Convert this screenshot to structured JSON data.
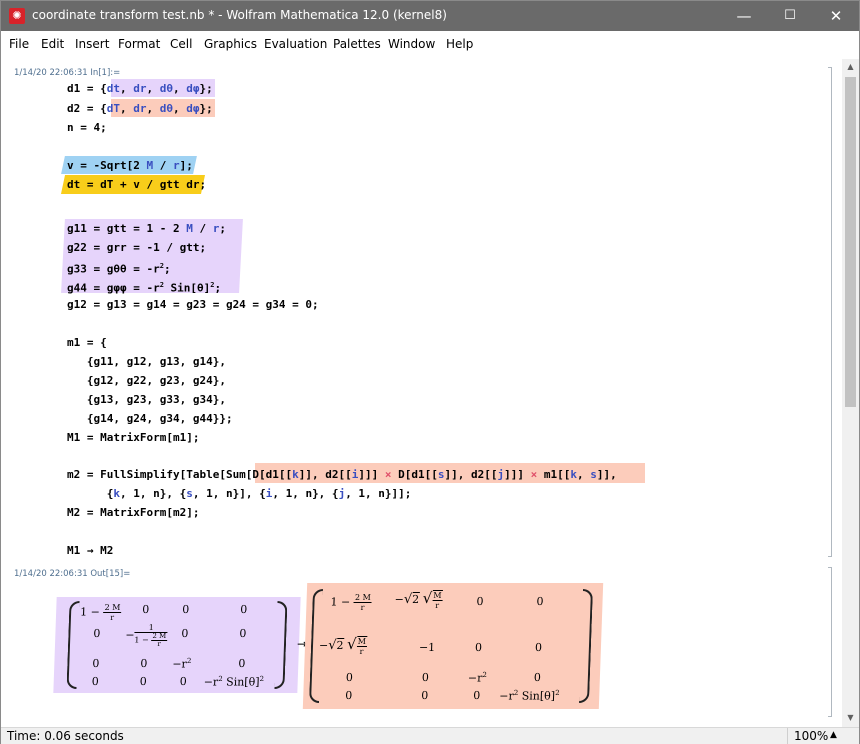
{
  "window": {
    "title": "coordinate transform test.nb * - Wolfram Mathematica 12.0 (kernel8)",
    "minimize": "—",
    "maximize": "☐",
    "close": "✕"
  },
  "menu": [
    "File",
    "Edit",
    "Insert",
    "Format",
    "Cell",
    "Graphics",
    "Evaluation",
    "Palettes",
    "Window",
    "Help"
  ],
  "input_cell": {
    "label": "1/14/20 22:06:31 In[1]:="
  },
  "output_cell": {
    "label": "1/14/20 22:06:31 Out[15]=",
    "arrow": "→",
    "left_matrix": {
      "r0": [
        "1 − ",
        "2 M",
        "r",
        "0",
        "0",
        "0"
      ],
      "r1": [
        "0",
        "−",
        "1",
        "1 − ",
        "2 M",
        "r",
        "0",
        "0"
      ],
      "r2": [
        "0",
        "0",
        "−r",
        "2",
        "0"
      ],
      "r3": [
        "0",
        "0",
        "0",
        "−r",
        "2",
        " Sin[θ]",
        "2"
      ]
    },
    "right_matrix": {
      "r0": [
        "1 − ",
        "2 M",
        "r",
        "−",
        "2",
        "M",
        "r",
        "0",
        "0"
      ],
      "r1": [
        "−",
        "2",
        "M",
        "r",
        "−1",
        "0",
        "0"
      ],
      "r2": [
        "0",
        "0",
        "−r",
        "2",
        "0"
      ],
      "r3": [
        "0",
        "0",
        "0",
        "−r",
        "2",
        " Sin[θ]",
        "2"
      ]
    }
  },
  "status": {
    "time": "Time: 0.06 seconds",
    "zoom": "100%",
    "zoom_arrow": "▲"
  },
  "colors": {
    "titlebar": "#6a6a6a",
    "lavender": "#e6d4fb",
    "salmon": "#fcccbb",
    "skyblue": "#9fd2f3",
    "yellow": "#f8cd1a"
  }
}
